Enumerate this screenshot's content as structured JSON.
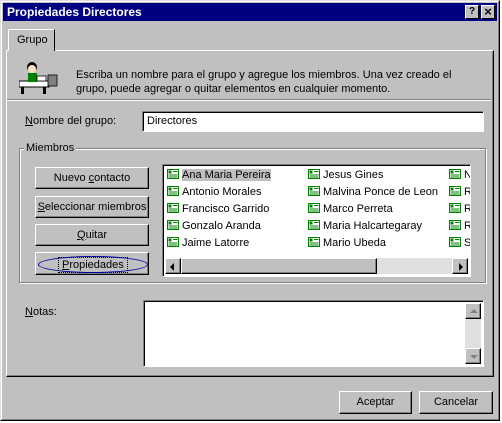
{
  "window": {
    "title": "Propiedades Directores",
    "help_button": "?",
    "close_button": "×"
  },
  "tab": {
    "label": "Grupo"
  },
  "description": {
    "line1": "Escriba un nombre para el grupo y agregue los miembros. Una vez creado el",
    "line2": "grupo, puede agregar o quitar elementos en cualquier momento."
  },
  "group_name": {
    "label_u": "N",
    "label_rest": "ombre del grupo:",
    "value": "Directores"
  },
  "members": {
    "legend": "Miembros",
    "buttons": {
      "new_contact_a": "Nuevo ",
      "new_contact_u": "c",
      "new_contact_b": "ontacto",
      "select_u": "S",
      "select_rest": "eleccionar miembros",
      "remove_u": "Q",
      "remove_rest": "uitar",
      "properties_u": "P",
      "properties_rest": "ropiedades"
    },
    "list": {
      "col1": [
        "Ana Maria Pereira",
        "Antonio Morales",
        "Francisco Garrido",
        "Gonzalo Aranda",
        "Jaime Latorre"
      ],
      "col2": [
        "Jesus Gines",
        "Malvina Ponce de Leon",
        "Marco Perreta",
        "Maria Halcartegaray",
        "Mario Ubeda"
      ],
      "col3": [
        "N",
        "R",
        "R",
        "R",
        "S"
      ],
      "selected": "Ana Maria Pereira"
    }
  },
  "notes": {
    "label_u": "N",
    "label_rest": "otas:",
    "value": ""
  },
  "footer": {
    "accept": "Aceptar",
    "cancel": "Cancelar"
  },
  "icons": {
    "contact": "contact-card-icon",
    "illustration": "person-at-desk-icon"
  },
  "colors": {
    "titlebar": "#000080",
    "face": "#c0c0c0",
    "focus": "#0000a0"
  }
}
